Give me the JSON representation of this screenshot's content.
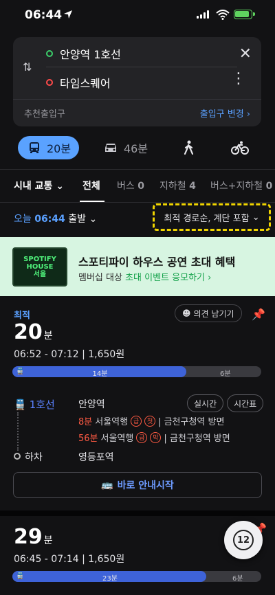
{
  "status": {
    "time": "06:44"
  },
  "route": {
    "from": "안양역 1호선",
    "to": "타임스퀘어",
    "footer_left": "추천출입구",
    "footer_right": "출입구 변경 ›"
  },
  "modes": {
    "transit_time": "20분",
    "car_time": "46분"
  },
  "tabs": {
    "scope": "시내 교통",
    "all": "전체",
    "bus": "버스",
    "bus_count": "0",
    "subway": "지하철",
    "subway_count": "4",
    "mix": "버스+지하철",
    "mix_count": "0"
  },
  "time_row": {
    "prefix": "오늘",
    "time": "06:44",
    "suffix": "출발",
    "sort": "최적 경로순, 계단 포함"
  },
  "ad": {
    "logo_line1": "SPOTIFY",
    "logo_line2": "HOUSE",
    "logo_line3": "서울",
    "title": "스포티파이 하우스 공연 초대 혜택",
    "sub_prefix": "멤버십 대상",
    "sub_highlight": "초대 이벤트 응모하기 ›"
  },
  "result1": {
    "badge": "최적",
    "feedback": "의견 남기기",
    "duration_num": "20",
    "duration_unit": "분",
    "times": "06:52 - 07:12  |  1,650원",
    "bar": {
      "ride_label": "14분",
      "walk_label": "6분",
      "ride_fraction": 0.7
    },
    "line": "1호선",
    "station": "안양역",
    "realtime": "실시간",
    "timetable": "시간표",
    "arr1_min": "8분",
    "arr1_dest": "서울역행",
    "arr1_badge1": "급",
    "arr1_badge2": "첫",
    "arr1_dir": "| 금천구청역 방면",
    "arr2_min": "56분",
    "arr2_dest": "서울역행",
    "arr2_badge1": "급",
    "arr2_badge2": "막",
    "arr2_dir": "| 금천구청역 방면",
    "alight": "하차",
    "alight_station": "영등포역",
    "start_button": "바로 안내시작"
  },
  "result2": {
    "duration_num": "29",
    "duration_unit": "분",
    "times": "06:45 - 07:14  |  1,650원",
    "bar": {
      "ride_label": "23분",
      "walk_label": "6분",
      "ride_fraction": 0.78
    },
    "fab_label": "12"
  },
  "colors": {
    "accent": "#5aa0ff",
    "line1": "#3e63d8",
    "warning": "#ff5a43",
    "highlight_box": "#f0d400"
  }
}
